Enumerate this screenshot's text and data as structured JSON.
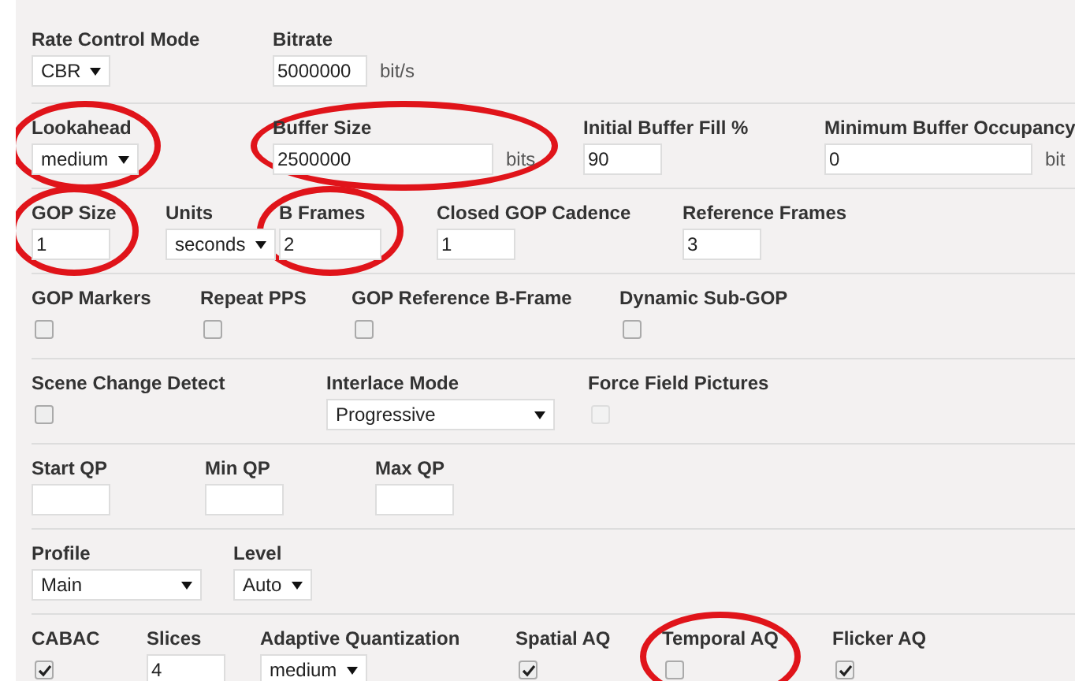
{
  "rows": [
    {
      "fields": [
        {
          "label": "Rate Control Mode",
          "kind": "select",
          "value": "CBR",
          "highlighted": false
        },
        {
          "label": "Bitrate",
          "kind": "text",
          "value": "5000000",
          "unit": "bit/s",
          "highlighted": false
        }
      ]
    },
    {
      "fields": [
        {
          "label": "Lookahead",
          "kind": "select",
          "value": "medium",
          "highlighted": true
        },
        {
          "label": "Buffer Size",
          "kind": "text",
          "value": "2500000",
          "unit": "bits",
          "highlighted": true
        },
        {
          "label": "Initial Buffer Fill %",
          "kind": "text",
          "value": "90",
          "highlighted": false
        },
        {
          "label": "Minimum Buffer Occupancy",
          "kind": "text",
          "value": "0",
          "unit": "bit",
          "highlighted": false
        }
      ]
    },
    {
      "fields": [
        {
          "label": "GOP Size",
          "kind": "text",
          "value": "1",
          "highlighted": true
        },
        {
          "label": "Units",
          "kind": "select",
          "value": "seconds",
          "highlighted": false
        },
        {
          "label": "B Frames",
          "kind": "text",
          "value": "2",
          "highlighted": true
        },
        {
          "label": "Closed GOP Cadence",
          "kind": "text",
          "value": "1",
          "highlighted": false
        },
        {
          "label": "Reference Frames",
          "kind": "text",
          "value": "3",
          "highlighted": false
        }
      ]
    },
    {
      "fields": [
        {
          "label": "GOP Markers",
          "kind": "checkbox",
          "checked": false,
          "disabled": false,
          "highlighted": false
        },
        {
          "label": "Repeat PPS",
          "kind": "checkbox",
          "checked": false,
          "disabled": false,
          "highlighted": false
        },
        {
          "label": "GOP Reference B-Frame",
          "kind": "checkbox",
          "checked": false,
          "disabled": false,
          "highlighted": false
        },
        {
          "label": "Dynamic Sub-GOP",
          "kind": "checkbox",
          "checked": false,
          "disabled": false,
          "highlighted": false
        }
      ]
    },
    {
      "fields": [
        {
          "label": "Scene Change Detect",
          "kind": "checkbox",
          "checked": false,
          "disabled": false,
          "highlighted": false
        },
        {
          "label": "Interlace Mode",
          "kind": "select",
          "value": "Progressive",
          "highlighted": false
        },
        {
          "label": "Force Field Pictures",
          "kind": "checkbox",
          "checked": false,
          "disabled": true,
          "highlighted": false
        }
      ]
    },
    {
      "fields": [
        {
          "label": "Start QP",
          "kind": "text",
          "highlighted": false
        },
        {
          "label": "Min QP",
          "kind": "text",
          "highlighted": false
        },
        {
          "label": "Max QP",
          "kind": "text",
          "highlighted": false
        }
      ]
    },
    {
      "fields": [
        {
          "label": "Profile",
          "kind": "select",
          "value": "Main",
          "highlighted": false
        },
        {
          "label": "Level",
          "kind": "select",
          "value": "Auto",
          "highlighted": false
        }
      ]
    },
    {
      "fields": [
        {
          "label": "CABAC",
          "kind": "checkbox",
          "checked": true,
          "disabled": false,
          "highlighted": false
        },
        {
          "label": "Slices",
          "kind": "text",
          "value": "4",
          "highlighted": false
        },
        {
          "label": "Adaptive Quantization",
          "kind": "select",
          "value": "medium",
          "highlighted": false
        },
        {
          "label": "Spatial AQ",
          "kind": "checkbox",
          "checked": true,
          "disabled": false,
          "highlighted": false
        },
        {
          "label": "Temporal AQ",
          "kind": "checkbox",
          "checked": false,
          "disabled": false,
          "highlighted": true
        },
        {
          "label": "Flicker AQ",
          "kind": "checkbox",
          "checked": true,
          "disabled": false,
          "highlighted": false
        }
      ]
    }
  ]
}
